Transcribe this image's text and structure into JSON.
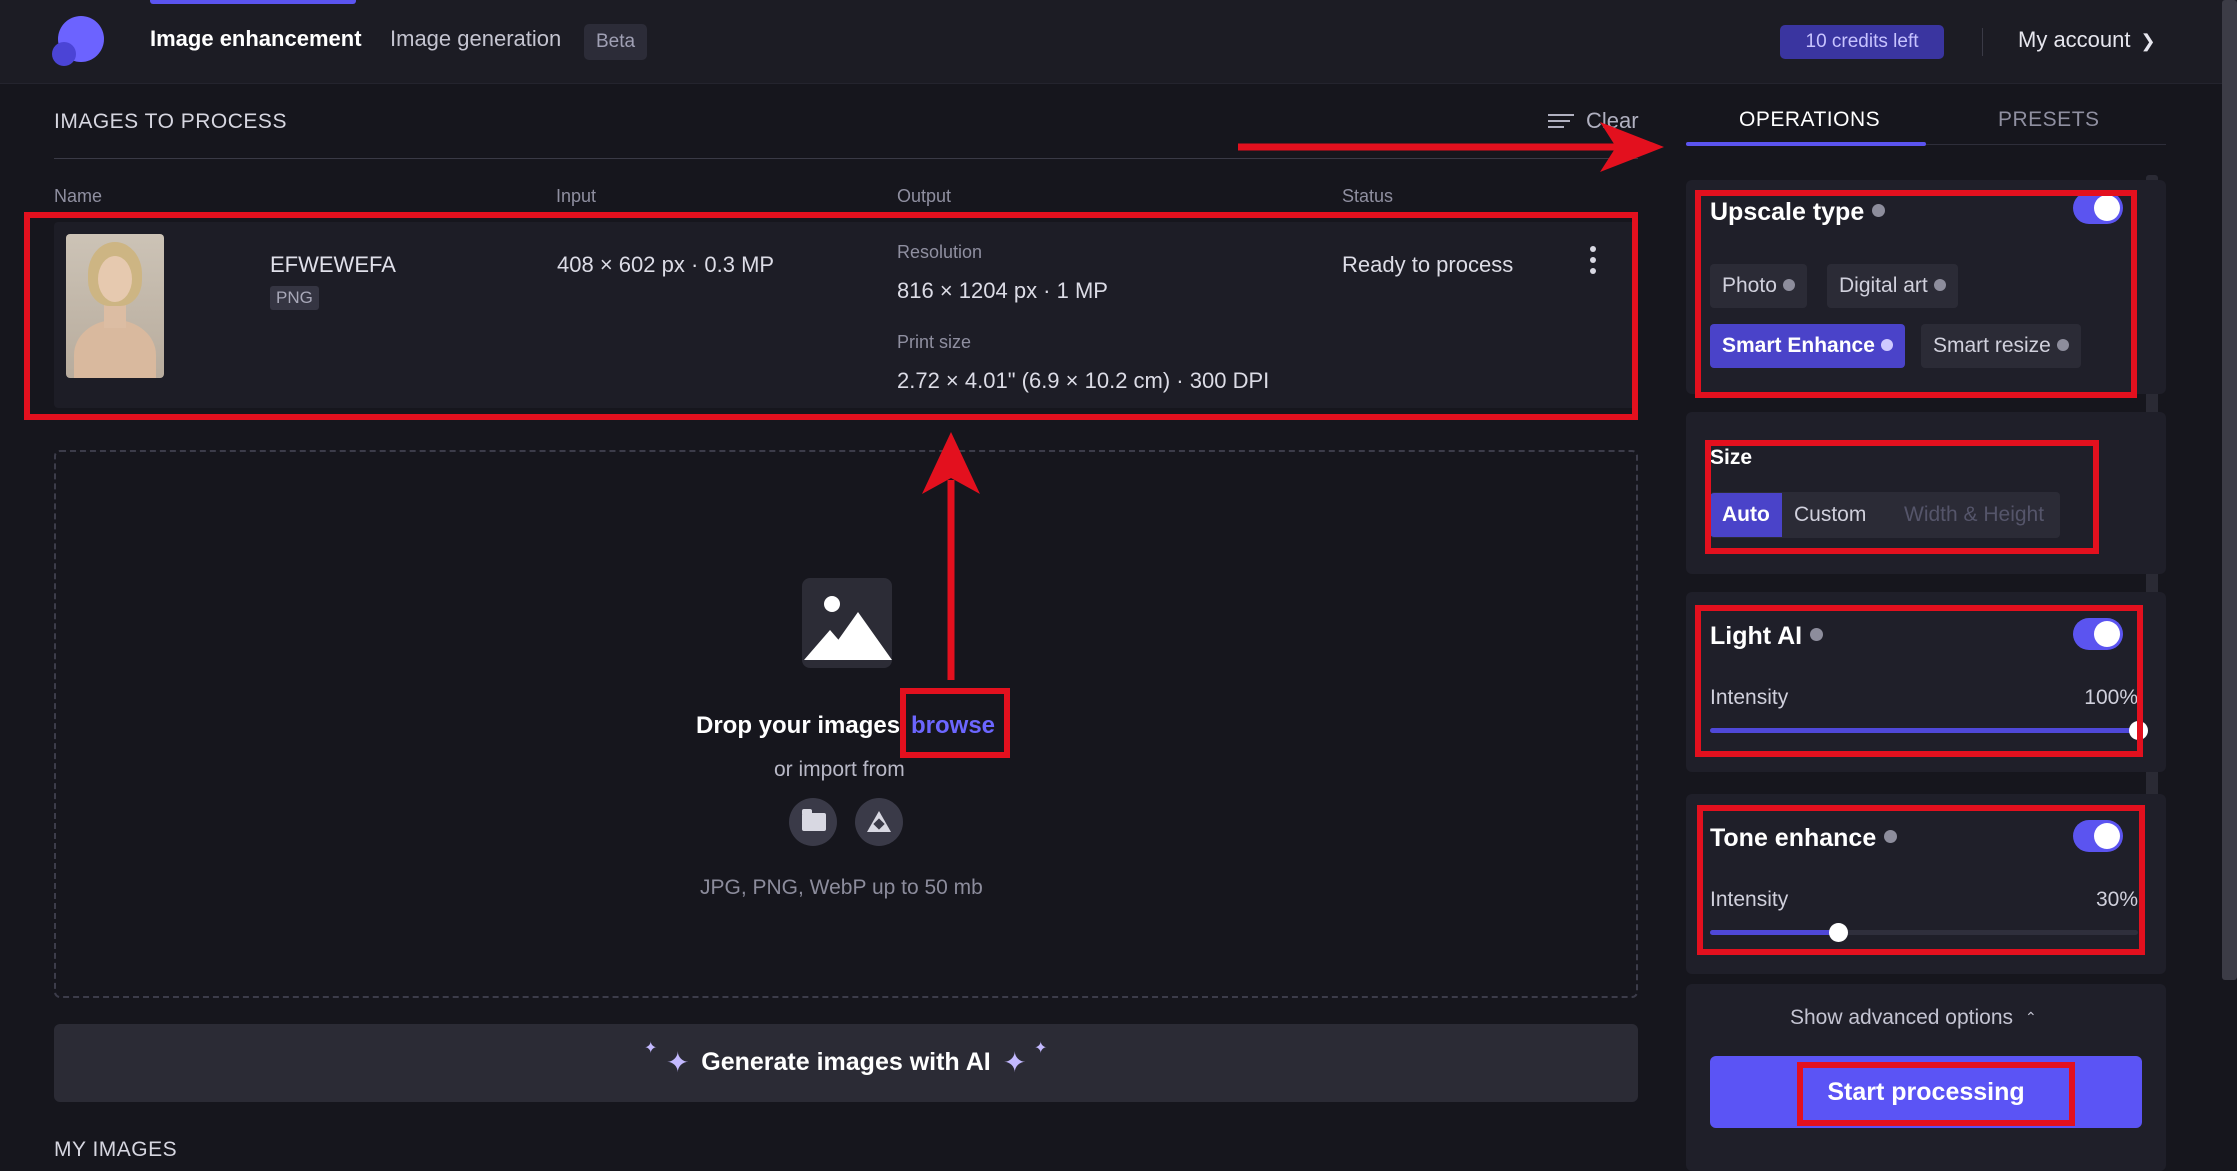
{
  "topbar": {
    "nav_active": "Image enhancement",
    "nav_generation": "Image generation",
    "beta_badge": "Beta",
    "credits": "10 credits left",
    "account": "My account",
    "account_icon": "chevron-down-icon"
  },
  "queue": {
    "title": "IMAGES TO PROCESS",
    "clear_label": "Clear",
    "columns": {
      "name": "Name",
      "input": "Input",
      "output": "Output",
      "status": "Status"
    },
    "item": {
      "file_name": "EFWEWEFA",
      "file_type": "PNG",
      "input": "408 × 602 px · 0.3 MP",
      "resolution_label": "Resolution",
      "resolution": "816 × 1204 px · 1 MP",
      "print_size_label": "Print size",
      "print_size": "2.72 × 4.01\" (6.9 × 10.2 cm) · 300 DPI",
      "status": "Ready to process"
    }
  },
  "dropzone": {
    "drop_text": "Drop your images",
    "browse": "browse",
    "import_from": "or import from",
    "formats": "JPG, PNG, WebP up to 50 mb",
    "sources": [
      "folder-icon",
      "google-drive-icon"
    ]
  },
  "generate": {
    "label": "Generate images with AI"
  },
  "my_images": {
    "title": "MY IMAGES"
  },
  "panel": {
    "tabs": {
      "operations": "OPERATIONS",
      "presets": "PRESETS"
    },
    "upscale": {
      "title": "Upscale type",
      "enabled": true,
      "options": [
        "Photo",
        "Digital art",
        "Smart Enhance",
        "Smart resize"
      ],
      "selected": "Smart Enhance"
    },
    "size": {
      "title": "Size",
      "options": [
        "Auto",
        "Custom",
        "Width & Height"
      ],
      "selected": "Auto"
    },
    "light_ai": {
      "title": "Light AI",
      "enabled": true,
      "intensity_label": "Intensity",
      "intensity": "100%",
      "level": 1.0
    },
    "tone": {
      "title": "Tone enhance",
      "enabled": true,
      "intensity_label": "Intensity",
      "intensity": "30%",
      "level": 0.3
    },
    "advanced": "Show advanced options",
    "start": "Start processing"
  },
  "colors": {
    "accent": "#5b54f0",
    "annotation": "#e3101e",
    "background": "#16161d"
  }
}
